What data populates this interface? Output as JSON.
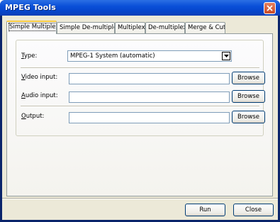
{
  "window": {
    "title": "MPEG Tools"
  },
  "tabs": [
    {
      "label": "Simple Multiplex",
      "active": true
    },
    {
      "label": "Simple De-multiplex",
      "active": false
    },
    {
      "label": "Multiplex",
      "active": false
    },
    {
      "label": "De-multiplex",
      "active": false
    },
    {
      "label": "Merge & Cut",
      "active": false
    }
  ],
  "form": {
    "type": {
      "mnemonic": "T",
      "rest": "ype:",
      "value": "MPEG-1 System (automatic)"
    },
    "video": {
      "mnemonic": "V",
      "rest": "ideo input:",
      "value": "",
      "browse": "Browse"
    },
    "audio": {
      "mnemonic": "A",
      "rest": "udio input:",
      "value": "",
      "browse": "Browse"
    },
    "output": {
      "mnemonic": "O",
      "rest": "utput:",
      "value": "",
      "browse": "Browse"
    }
  },
  "footer": {
    "run": "Run",
    "close": "Close"
  },
  "icons": {
    "close": "close-icon",
    "dropdown": "chevron-down-icon"
  }
}
